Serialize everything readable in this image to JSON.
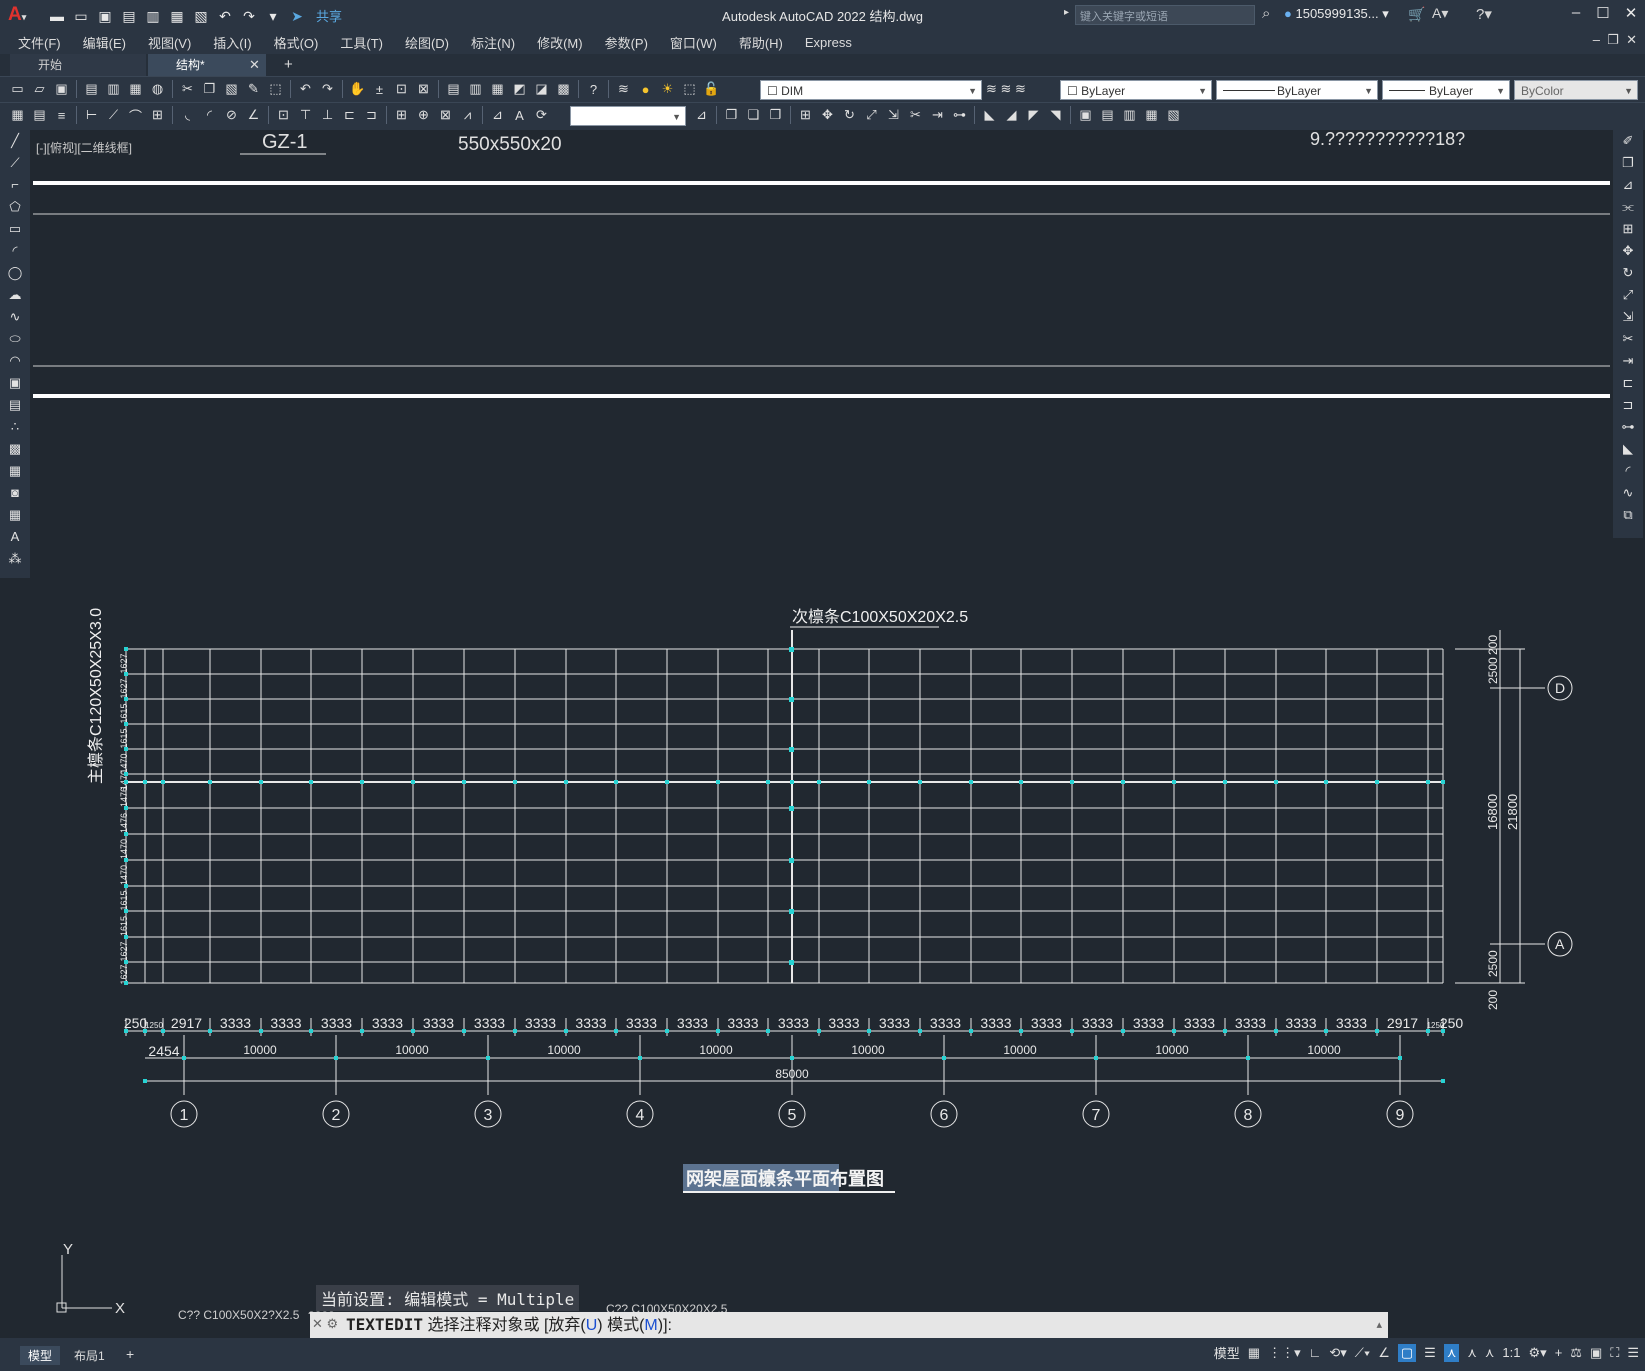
{
  "app": {
    "title": "Autodesk AutoCAD 2022    结构.dwg",
    "share_label": "共享",
    "search_placeholder": "键入关键字或短语",
    "user": "1505999135... ▾"
  },
  "menu": [
    "文件(F)",
    "编辑(E)",
    "视图(V)",
    "插入(I)",
    "格式(O)",
    "工具(T)",
    "绘图(D)",
    "标注(N)",
    "修改(M)",
    "参数(P)",
    "窗口(W)",
    "帮助(H)",
    "Express"
  ],
  "tabs": {
    "start": "开始",
    "active": "结构*"
  },
  "properties": {
    "layer": "DIM",
    "color": "ByLayer",
    "linetype": "ByLayer",
    "lineweight": "ByLayer",
    "plotstyle": "ByColor"
  },
  "drawing": {
    "viewport_label": "[-][俯视][二维线框]",
    "top_text_left": "GZ-1",
    "top_text_mid": "550x550x20",
    "top_text_right": "9.???????????18?",
    "secondary_purlin": "次檩条C100X50X20X2.5",
    "main_purlin": "主檩条C120X50X25X3.0",
    "plan_title": "网架屋面檩条平面布置图",
    "left_dims": [
      "1627",
      "1627",
      "1615",
      "1615",
      "1470",
      "1470",
      "1476",
      "1476",
      "1470",
      "1470",
      "1615",
      "1615",
      "1627",
      "1627"
    ],
    "right_dims": [
      "200",
      "2500",
      "16800",
      "21800",
      "2500",
      "200"
    ],
    "axis_letters": [
      "D",
      "A"
    ],
    "dim_row1": [
      "250",
      "1250",
      "2917",
      "3333",
      "3333",
      "3333",
      "3333",
      "3333",
      "3333",
      "3333",
      "3333",
      "3333",
      "3333",
      "3333",
      "3333",
      "3333",
      "3333",
      "3333",
      "3333",
      "3333",
      "3333",
      "3333",
      "3333",
      "3333",
      "3333",
      "3333",
      "2917",
      "1250",
      "250"
    ],
    "dim_row2_first": "2454",
    "dim_row2": [
      "10000",
      "10000",
      "10000",
      "10000",
      "10000",
      "10000",
      "10000",
      "10000"
    ],
    "dim_total": "85000",
    "axis_numbers": [
      "1",
      "2",
      "3",
      "4",
      "5",
      "6",
      "7",
      "8",
      "9"
    ],
    "bottom_label_a": "C?? C100X50X2?X2.5",
    "bottom_label_b": "C?? C100X50X20X2.5",
    "bottom_label_c": "????",
    "ucs_x": "X",
    "ucs_y": "Y"
  },
  "command": {
    "history": "当前设置: 编辑模式 = Multiple",
    "cmd": "TEXTEDIT",
    "prompt_a": " 选择注释对象或 [放弃(",
    "opt_u": "U",
    "prompt_b": ") 模式(",
    "opt_m": "M",
    "prompt_c": ")]:"
  },
  "status": {
    "model_tab": "模型",
    "layout_tab": "布局1",
    "model_label": "模型",
    "scale": "1:1"
  },
  "colors": {
    "bg": "#212830",
    "cyan": "#27d3d3",
    "white_line": "#ffffff"
  }
}
